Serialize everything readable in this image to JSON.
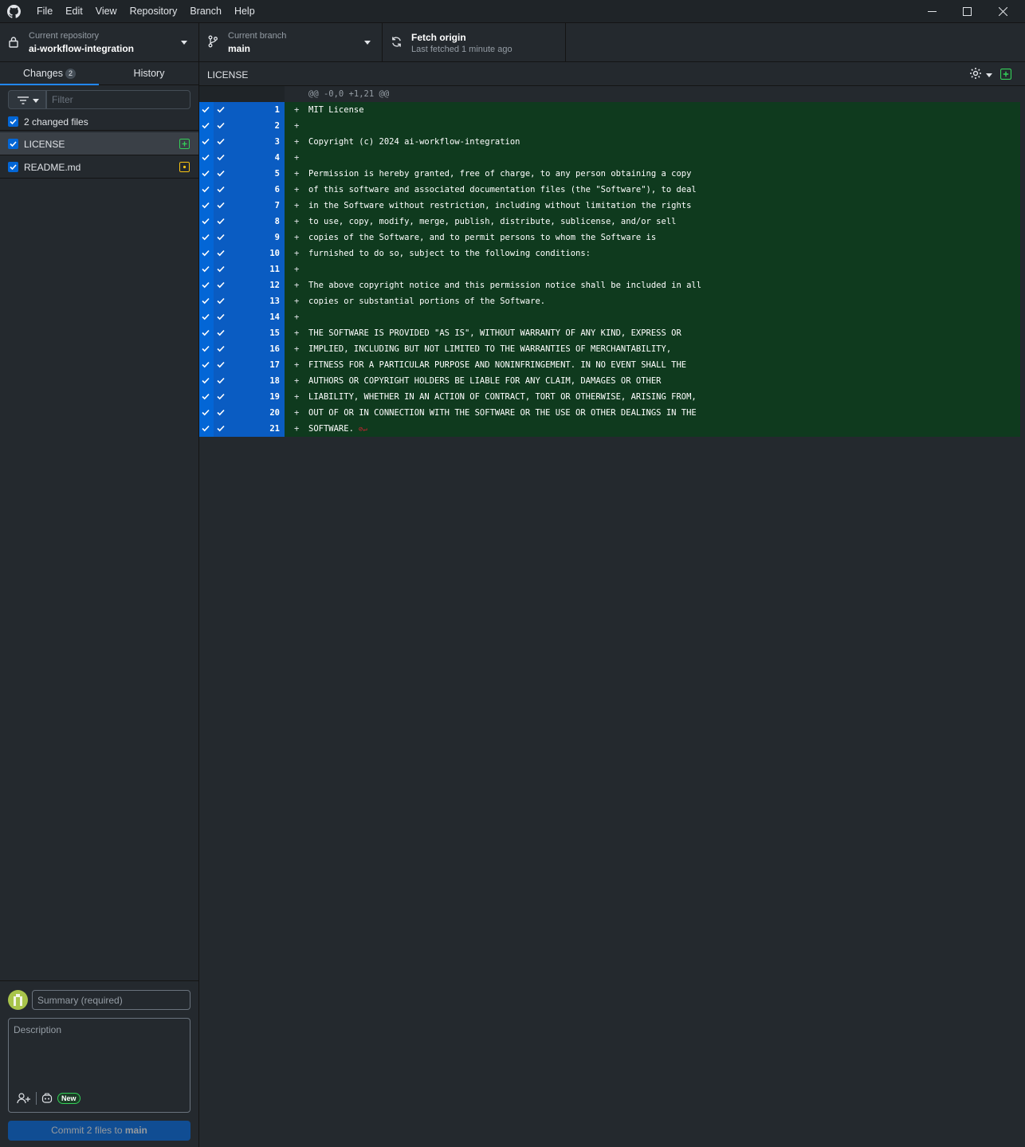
{
  "menu": [
    "File",
    "Edit",
    "View",
    "Repository",
    "Branch",
    "Help"
  ],
  "icons": {
    "app": "github-icon",
    "minimize": "minimize-icon",
    "maximize": "maximize-icon",
    "close": "close-icon",
    "lock": "lock-icon",
    "branch": "branch-icon",
    "sync": "sync-icon",
    "filter": "filter-icon",
    "settings": "gear-icon",
    "added": "file-added-icon",
    "modified": "file-modified-icon",
    "coauthor": "add-coauthor-icon",
    "copilot": "copilot-icon"
  },
  "toolbar": {
    "repo_label": "Current repository",
    "repo_name": "ai-workflow-integration",
    "branch_label": "Current branch",
    "branch_name": "main",
    "fetch_title": "Fetch origin",
    "fetch_sub": "Last fetched 1 minute ago"
  },
  "sidebar": {
    "tab_changes": "Changes",
    "changes_count": "2",
    "tab_history": "History",
    "filter_placeholder": "Filter",
    "changed_files_label": "2 changed files",
    "files": [
      {
        "name": "LICENSE",
        "status": "added"
      },
      {
        "name": "README.md",
        "status": "modified"
      }
    ]
  },
  "commit": {
    "summary_placeholder": "Summary (required)",
    "description_placeholder": "Description",
    "new_badge": "New",
    "button_prefix": "Commit 2 files to",
    "button_branch": "main"
  },
  "diff": {
    "path": "LICENSE",
    "hunk_header": "@@ -0,0 +1,21 @@",
    "lines": [
      "MIT License",
      "",
      "Copyright (c) 2024 ai-workflow-integration",
      "",
      "Permission is hereby granted, free of charge, to any person obtaining a copy",
      "of this software and associated documentation files (the \"Software\"), to deal",
      "in the Software without restriction, including without limitation the rights",
      "to use, copy, modify, merge, publish, distribute, sublicense, and/or sell",
      "copies of the Software, and to permit persons to whom the Software is",
      "furnished to do so, subject to the following conditions:",
      "",
      "The above copyright notice and this permission notice shall be included in all",
      "copies or substantial portions of the Software.",
      "",
      "THE SOFTWARE IS PROVIDED \"AS IS\", WITHOUT WARRANTY OF ANY KIND, EXPRESS OR",
      "IMPLIED, INCLUDING BUT NOT LIMITED TO THE WARRANTIES OF MERCHANTABILITY,",
      "FITNESS FOR A PARTICULAR PURPOSE AND NONINFRINGEMENT. IN NO EVENT SHALL THE",
      "AUTHORS OR COPYRIGHT HOLDERS BE LIABLE FOR ANY CLAIM, DAMAGES OR OTHER",
      "LIABILITY, WHETHER IN AN ACTION OF CONTRACT, TORT OR OTHERWISE, ARISING FROM,",
      "OUT OF OR IN CONNECTION WITH THE SOFTWARE OR THE USE OR OTHER DEALINGS IN THE",
      "SOFTWARE."
    ],
    "no_newline_marker": "⊘↵"
  },
  "colors": {
    "accent": "#0366d6",
    "added_bg": "#0f3a1e",
    "added_icon": "#34d058",
    "modified_icon": "#f9c513"
  }
}
